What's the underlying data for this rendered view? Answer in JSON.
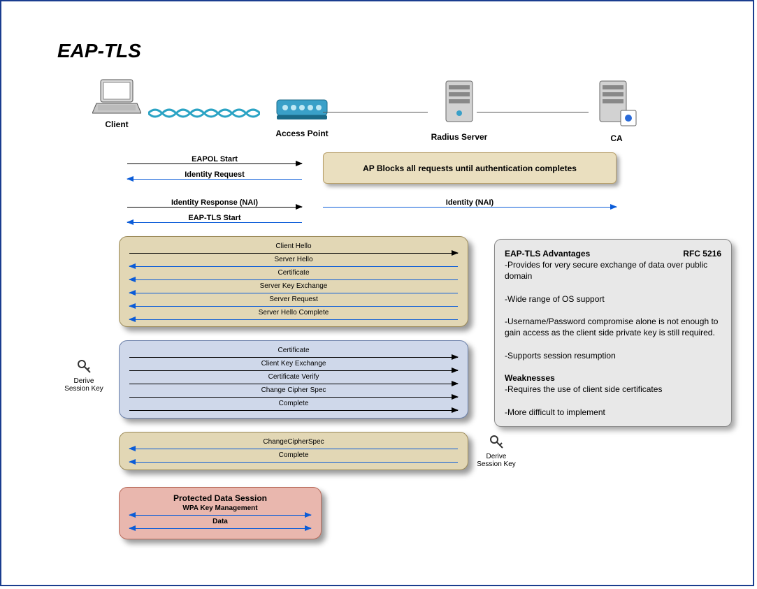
{
  "title": "EAP-TLS",
  "nodes": {
    "client": "Client",
    "ap": "Access Point",
    "radius": "Radius Server",
    "ca": "CA"
  },
  "top_arrows": {
    "eapol_start": "EAPOL Start",
    "identity_request": "Identity Request",
    "identity_response": "Identity Response (NAI)",
    "eap_tls_start": "EAP-TLS Start",
    "identity_nai": "Identity (NAI)"
  },
  "ap_block": "AP Blocks all requests until authentication completes",
  "panel1": [
    "Client Hello",
    "Server Hello",
    "Certificate",
    "Server Key Exchange",
    "Server Request",
    "Server Hello Complete"
  ],
  "panel2": [
    "Certificate",
    "Client Key Exchange",
    "Certificate Verify",
    "Change Cipher Spec",
    "Complete"
  ],
  "panel3": [
    "ChangeCipherSpec",
    "Complete"
  ],
  "panel4": {
    "title": "Protected Data Session",
    "rows": [
      "WPA Key Management",
      "Data"
    ]
  },
  "derive_key": "Derive\nSession Key",
  "sidebox": {
    "title": "EAP-TLS Advantages",
    "rfc": "RFC 5216",
    "adv": [
      "-Provides for very secure exchange of data over public domain",
      "-Wide range of OS support",
      "-Username/Password compromise alone is not enough to gain access as the client side private key is still required.",
      "-Supports session resumption"
    ],
    "weak_title": "Weaknesses",
    "weak": [
      "-Requires the use of client side certificates",
      "-More difficult to implement"
    ]
  }
}
